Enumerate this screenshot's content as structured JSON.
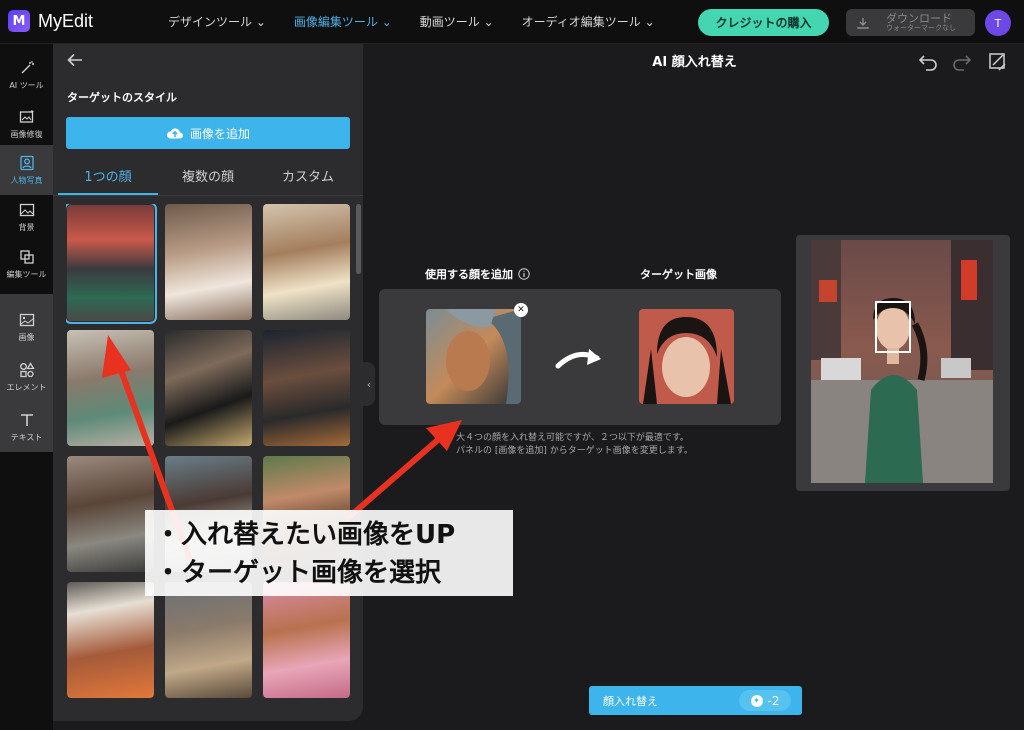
{
  "header": {
    "logo_text": "MyEdit",
    "logo_mark": "M",
    "nav": [
      {
        "label": "デザインツール ⌄"
      },
      {
        "label": "画像編集ツール ⌄"
      },
      {
        "label": "動画ツール ⌄"
      },
      {
        "label": "オーディオ編集ツール ⌄"
      }
    ],
    "credit_button": "クレジットの購入",
    "download": {
      "label": "ダウンロード",
      "sub": "ウォーターマークなし"
    },
    "avatar_initial": "T"
  },
  "sidebar": {
    "items": [
      {
        "label": "AI ツール",
        "icon": "magic-wand-icon"
      },
      {
        "label": "画像修復",
        "icon": "image-repair-icon"
      },
      {
        "label": "人物写真",
        "icon": "portrait-icon"
      },
      {
        "label": "背景",
        "icon": "background-icon"
      },
      {
        "label": "編集ツール",
        "icon": "crop-icon"
      },
      {
        "label": "画像",
        "icon": "image-icon"
      },
      {
        "label": "エレメント",
        "icon": "shapes-icon"
      },
      {
        "label": "テキスト",
        "icon": "text-icon"
      }
    ]
  },
  "panel": {
    "title": "ターゲットのスタイル",
    "add_button": "画像を追加",
    "tabs": [
      {
        "label": "1つの顔"
      },
      {
        "label": "複数の顔"
      },
      {
        "label": "カスタム"
      }
    ]
  },
  "canvas": {
    "title": "AI 顔入れ替え",
    "add_face_label": "使用する顔を追加",
    "target_label": "ターゲット画像",
    "note_line1": "大４つの顔を入れ替え可能ですが、２つ以下が最適です。",
    "note_line2": "パネルの [画像を追加] からターゲット画像を変更します。",
    "action_button": "顔入れ替え",
    "cost": "-2"
  },
  "annotation": {
    "line1": "・入れ替えたい画像をUP",
    "line2": "・ターゲット画像を選択"
  },
  "colors": {
    "accent": "#3eb4ec",
    "credit": "#43d6b0",
    "arrow": "#e8321f"
  }
}
